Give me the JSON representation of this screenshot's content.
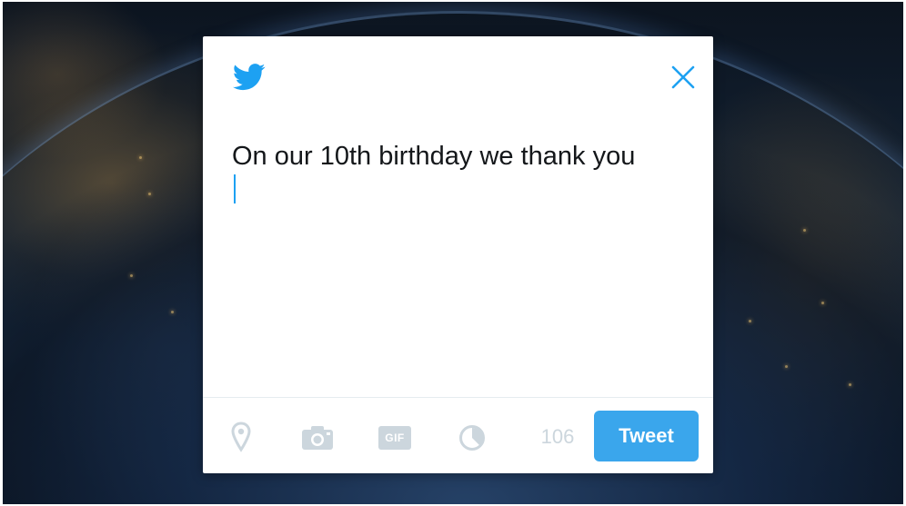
{
  "compose": {
    "text": "On our 10th birthday we thank you",
    "remaining_characters": "106"
  },
  "toolbar": {
    "icons": [
      "location-pin-icon",
      "camera-icon",
      "gif-icon",
      "poll-icon"
    ],
    "gif_label": "GIF"
  },
  "actions": {
    "tweet_label": "Tweet"
  },
  "colors": {
    "brand": "#1da1f2",
    "button": "#3aa6ec",
    "icon_gray": "#ccd6dd"
  }
}
